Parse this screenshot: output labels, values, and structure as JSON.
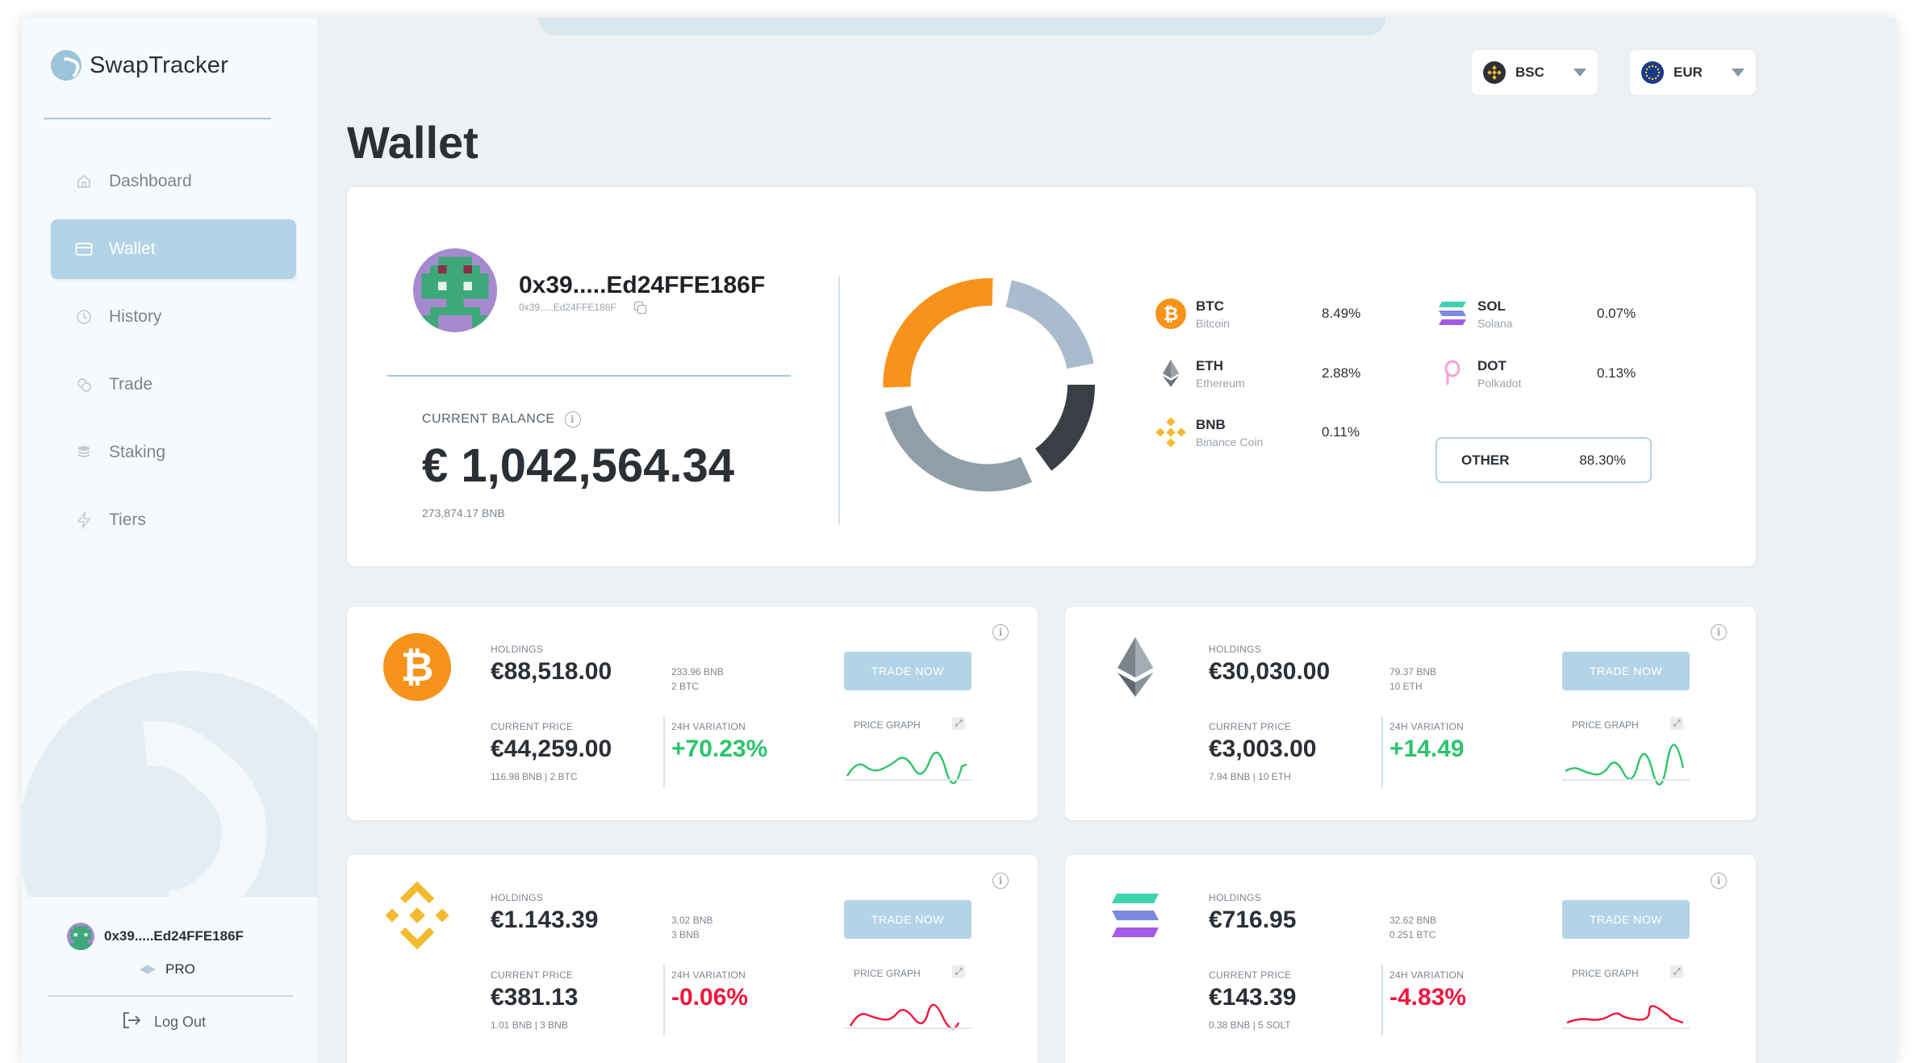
{
  "app": {
    "name": "SwapTracker"
  },
  "sidebar": {
    "items": [
      {
        "label": "Dashboard",
        "icon": "home-icon"
      },
      {
        "label": "Wallet",
        "icon": "wallet-icon",
        "active": true
      },
      {
        "label": "History",
        "icon": "clock-icon"
      },
      {
        "label": "Trade",
        "icon": "coins-icon"
      },
      {
        "label": "Staking",
        "icon": "stack-icon"
      },
      {
        "label": "Tiers",
        "icon": "lightning-icon"
      }
    ],
    "user_address": "0x39.....Ed24FFE186F",
    "tier": "PRO",
    "logout_label": "Log Out"
  },
  "header": {
    "network": "BSC",
    "currency": "EUR",
    "title": "Wallet"
  },
  "summary": {
    "address": "0x39.....Ed24FFE186F",
    "address_short": "0x39.....Ed24FFE186F",
    "balance_label": "CURRENT BALANCE",
    "balance_value": "€ 1,042,564.34",
    "balance_bnb": "273,874.17 BNB",
    "allocation": [
      {
        "symbol": "BTC",
        "name": "Bitcoin",
        "pct": "8.49%"
      },
      {
        "symbol": "ETH",
        "name": "Ethereum",
        "pct": "2.88%"
      },
      {
        "symbol": "BNB",
        "name": "Binance Coin",
        "pct": "0.11%"
      },
      {
        "symbol": "SOL",
        "name": "Solana",
        "pct": "0.07%"
      },
      {
        "symbol": "DOT",
        "name": "Polkadot",
        "pct": "0.13%"
      }
    ],
    "other": {
      "label": "OTHER",
      "pct": "88.30%"
    },
    "donut_colors": [
      "#f7931a",
      "#a9bccd",
      "#3a3f45",
      "#8e9fa8"
    ]
  },
  "labels": {
    "holdings": "HOLDINGS",
    "current_price": "CURRENT PRICE",
    "variation": "24H VARIATION",
    "price_graph": "PRICE GRAPH",
    "trade_now": "TRADE NOW"
  },
  "assets": [
    {
      "symbol": "BTC",
      "holdings": "€88,518.00",
      "holdings_sub1": "233.96 BNB",
      "holdings_sub2": "2 BTC",
      "price": "€44,259.00",
      "price_sub": "116.98 BNB | 2 BTC",
      "variation": "+70.23%",
      "trend": "up"
    },
    {
      "symbol": "ETH",
      "holdings": "€30,030.00",
      "holdings_sub1": "79.37 BNB",
      "holdings_sub2": "10 ETH",
      "price": "€3,003.00",
      "price_sub": "7.94 BNB | 10 ETH",
      "variation": "+14.49",
      "trend": "up"
    },
    {
      "symbol": "BNB",
      "holdings": "€1.143.39",
      "holdings_sub1": "3.02 BNB",
      "holdings_sub2": "3 BNB",
      "price": "€381.13",
      "price_sub": "1.01 BNB | 3 BNB",
      "variation": "-0.06%",
      "trend": "down"
    },
    {
      "symbol": "SOL",
      "holdings": "€716.95",
      "holdings_sub1": "32.62 BNB",
      "holdings_sub2": "0.251 BTC",
      "price": "€143.39",
      "price_sub": "0.38 BNB | 5 SOLT",
      "variation": "-4.83%",
      "trend": "down"
    }
  ],
  "colors": {
    "accent": "#b3d4e6",
    "positive": "#2cc46b",
    "negative": "#f0163d",
    "btc": "#f7931a",
    "bnb": "#f3ba2f"
  }
}
